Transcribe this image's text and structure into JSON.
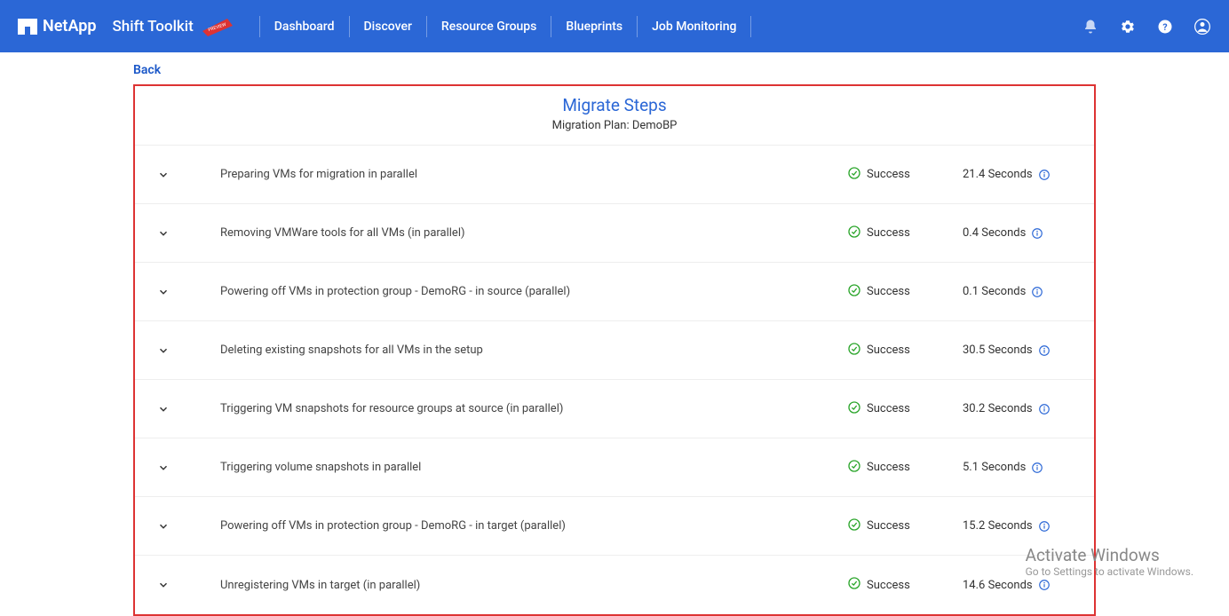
{
  "header": {
    "brand": "NetApp",
    "product": "Shift Toolkit",
    "preview_badge": "PREVIEW",
    "nav": [
      "Dashboard",
      "Discover",
      "Resource Groups",
      "Blueprints",
      "Job Monitoring"
    ]
  },
  "back_label": "Back",
  "panel": {
    "title": "Migrate Steps",
    "subtitle": "Migration Plan: DemoBP"
  },
  "status_label": "Success",
  "steps": [
    {
      "desc": "Preparing VMs for migration in parallel",
      "duration": "21.4 Seconds"
    },
    {
      "desc": "Removing VMWare tools for all VMs (in parallel)",
      "duration": "0.4 Seconds"
    },
    {
      "desc": "Powering off VMs in protection group - DemoRG - in source (parallel)",
      "duration": "0.1 Seconds"
    },
    {
      "desc": "Deleting existing snapshots for all VMs in the setup",
      "duration": "30.5 Seconds"
    },
    {
      "desc": "Triggering VM snapshots for resource groups at source (in parallel)",
      "duration": "30.2 Seconds"
    },
    {
      "desc": "Triggering volume snapshots in parallel",
      "duration": "5.1 Seconds"
    },
    {
      "desc": "Powering off VMs in protection group - DemoRG - in target (parallel)",
      "duration": "15.2 Seconds"
    },
    {
      "desc": "Unregistering VMs in target (in parallel)",
      "duration": "14.6 Seconds"
    }
  ],
  "watermark": {
    "title": "Activate Windows",
    "sub": "Go to Settings to activate Windows."
  }
}
